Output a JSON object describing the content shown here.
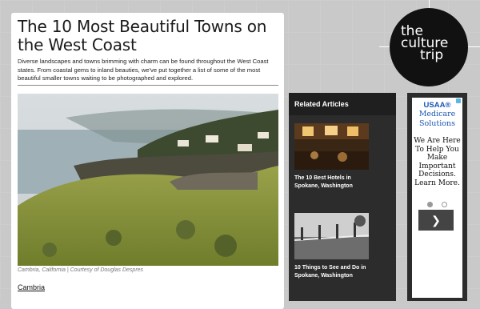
{
  "article": {
    "title": "The 10 Most Beautiful Towns on the West Coast",
    "intro": "Diverse landscapes and towns brimming with charm can be found throughout the West Coast states. From coastal gems to inland beauties, we've put together a list of some of the most beautiful smaller towns waiting to be photographed and explored.",
    "hero_caption": "Cambria, California | Courtesy of Douglas Despres",
    "section_link": "Cambria"
  },
  "related": {
    "heading": "Related Articles",
    "items": [
      {
        "title": "The 10 Best Hotels in Spokane, Washington"
      },
      {
        "title": "10 Things to See and Do in Spokane, Washington"
      }
    ]
  },
  "ad": {
    "brand_line1": "USAA®",
    "brand_line2": "Medicare Solutions",
    "copy": "We Are Here To Help You Make Important Decisions. Learn More.",
    "next_glyph": "❯"
  },
  "logo": {
    "line1": "the",
    "line2": "culture",
    "line3": "trip"
  }
}
